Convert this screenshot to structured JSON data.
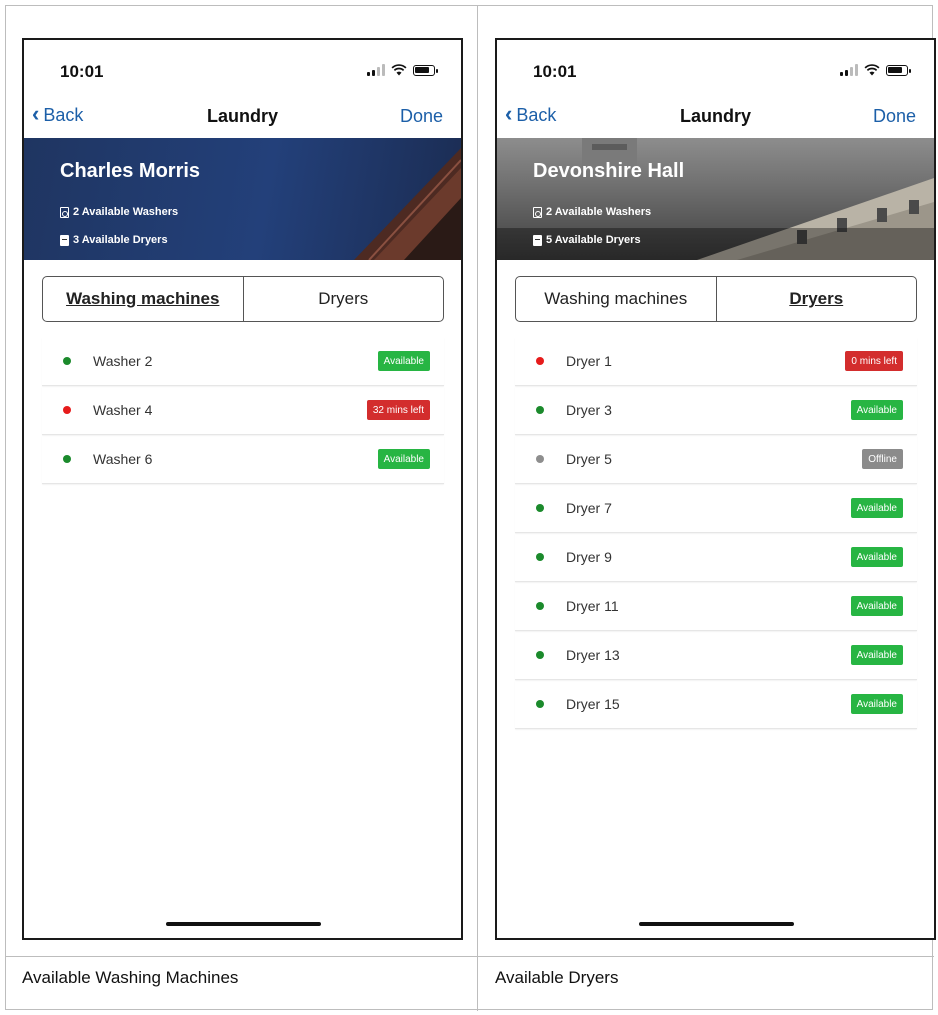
{
  "colors": {
    "available": "#27b543",
    "busy": "#d32d2d",
    "offline": "#8b8b8b",
    "dot_green": "#1b8a2c",
    "dot_red": "#e61b1b",
    "dot_grey": "#8e8e8e",
    "link": "#1c5fa8"
  },
  "captions": {
    "left": "Available Washing Machines",
    "right": "Available Dryers"
  },
  "screens": [
    {
      "status_time": "10:01",
      "nav": {
        "back": "Back",
        "title": "Laundry",
        "done": "Done"
      },
      "hero": {
        "name": "Charles Morris",
        "washers": "2 Available Washers",
        "dryers": "3 Available Dryers"
      },
      "tabs": [
        {
          "label": "Washing machines",
          "active": true
        },
        {
          "label": "Dryers",
          "active": false
        }
      ],
      "items": [
        {
          "name": "Washer 2",
          "status": "Available",
          "state": "available"
        },
        {
          "name": "Washer 4",
          "status": "32 mins left",
          "state": "busy"
        },
        {
          "name": "Washer 6",
          "status": "Available",
          "state": "available"
        }
      ]
    },
    {
      "status_time": "10:01",
      "nav": {
        "back": "Back",
        "title": "Laundry",
        "done": "Done"
      },
      "hero": {
        "name": "Devonshire Hall",
        "washers": "2 Available Washers",
        "dryers": "5 Available Dryers"
      },
      "tabs": [
        {
          "label": "Washing machines",
          "active": false
        },
        {
          "label": "Dryers",
          "active": true
        }
      ],
      "items": [
        {
          "name": "Dryer 1",
          "status": "0 mins left",
          "state": "busy"
        },
        {
          "name": "Dryer 3",
          "status": "Available",
          "state": "available"
        },
        {
          "name": "Dryer 5",
          "status": "Offline",
          "state": "offline"
        },
        {
          "name": "Dryer 7",
          "status": "Available",
          "state": "available"
        },
        {
          "name": "Dryer 9",
          "status": "Available",
          "state": "available"
        },
        {
          "name": "Dryer 11",
          "status": "Available",
          "state": "available"
        },
        {
          "name": "Dryer 13",
          "status": "Available",
          "state": "available"
        },
        {
          "name": "Dryer 15",
          "status": "Available",
          "state": "available"
        }
      ]
    }
  ]
}
